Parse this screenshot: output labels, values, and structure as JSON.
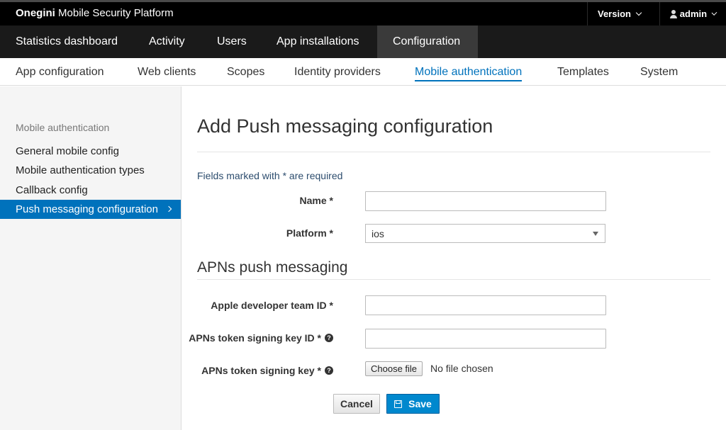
{
  "brand": {
    "bold": "Onegini",
    "rest": " Mobile Security Platform"
  },
  "topbar": {
    "version_label": "Version",
    "user_label": "admin"
  },
  "primary_nav": [
    {
      "label": "Statistics dashboard"
    },
    {
      "label": "Activity"
    },
    {
      "label": "Users"
    },
    {
      "label": "App installations"
    },
    {
      "label": "Configuration",
      "active": true
    }
  ],
  "secondary_nav": [
    {
      "label": "App configuration"
    },
    {
      "label": "Web clients"
    },
    {
      "label": "Scopes"
    },
    {
      "label": "Identity providers"
    },
    {
      "label": "Mobile authentication",
      "active": true
    },
    {
      "label": "Templates"
    },
    {
      "label": "System"
    }
  ],
  "sidebar": {
    "heading": "Mobile authentication",
    "items": [
      {
        "label": "General mobile config"
      },
      {
        "label": "Mobile authentication types"
      },
      {
        "label": "Callback config"
      },
      {
        "label": "Push messaging configuration",
        "active": true
      }
    ]
  },
  "main": {
    "title": "Add Push messaging configuration",
    "required_note": "Fields marked with * are required",
    "name_label": "Name *",
    "name_value": "",
    "platform_label": "Platform *",
    "platform_value": "ios",
    "apns_section_title": "APNs push messaging",
    "team_id_label": "Apple developer team ID *",
    "team_id_value": "",
    "key_id_label": "APNs token signing key ID *",
    "key_id_value": "",
    "key_label": "APNs token signing key *",
    "file_button": "Choose file",
    "file_status": "No file chosen",
    "help_glyph": "?",
    "cancel_label": "Cancel",
    "save_label": "Save"
  },
  "colors": {
    "accent": "#0072bc",
    "save_button": "#0088ce",
    "topbar": "#000000",
    "primary_nav": "#1a1a1a"
  }
}
